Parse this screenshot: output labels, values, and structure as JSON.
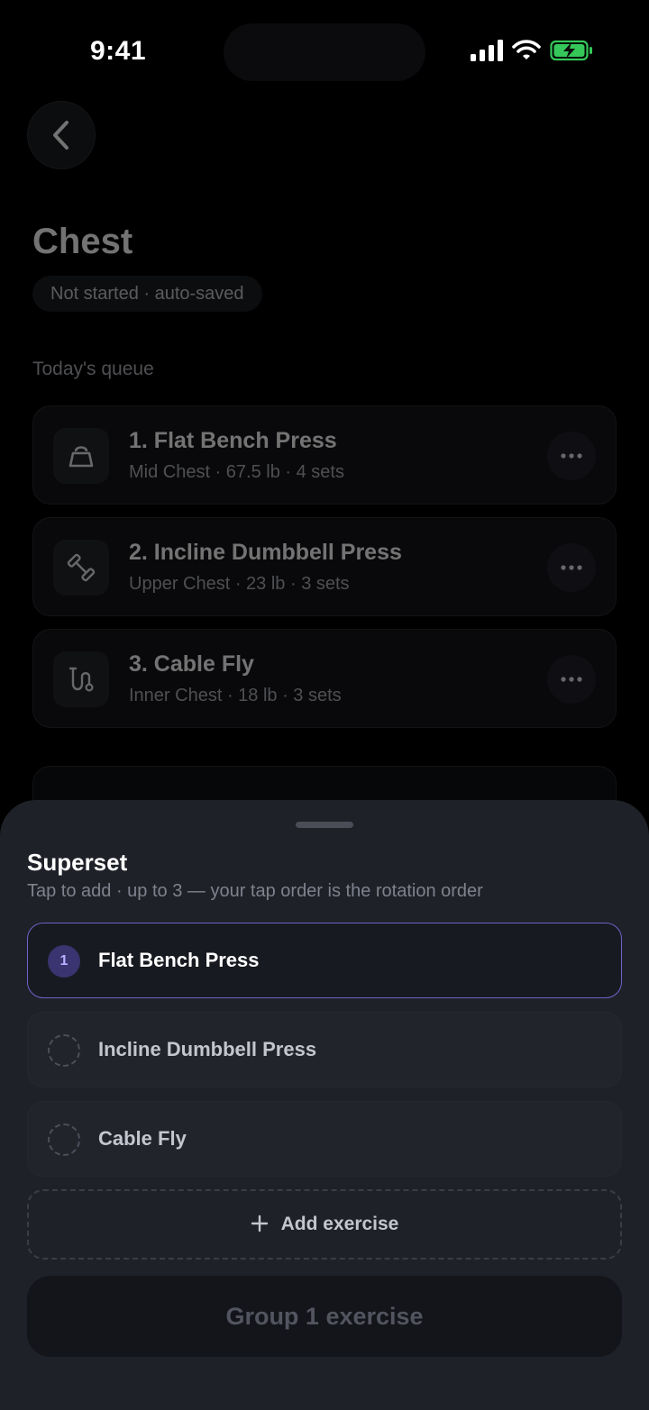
{
  "status_bar": {
    "time": "9:41"
  },
  "page": {
    "title": "Chest",
    "status_chip": "Not started · auto-saved",
    "section_label": "Today's queue",
    "queue": [
      {
        "name": "1. Flat Bench Press",
        "meta": "Mid Chest · 67.5 lb · 4 sets",
        "icon": "kettlebell-icon"
      },
      {
        "name": "2. Incline Dumbbell Press",
        "meta": "Upper Chest · 23 lb · 3 sets",
        "icon": "dumbbell-icon"
      },
      {
        "name": "3. Cable Fly",
        "meta": "Inner Chest · 18 lb · 3 sets",
        "icon": "cable-icon"
      }
    ]
  },
  "sheet": {
    "title": "Superset",
    "subtitle": "Tap to add · up to 3 — your tap order is the rotation order",
    "options": [
      {
        "label": "Flat Bench Press",
        "order": "1",
        "selected": true
      },
      {
        "label": "Incline Dumbbell Press",
        "order": "",
        "selected": false
      },
      {
        "label": "Cable Fly",
        "order": "",
        "selected": false
      }
    ],
    "add_label": "Add exercise",
    "group_button_label": "Group 1 exercise"
  },
  "colors": {
    "accent": "#6e63c8",
    "sheet_bg": "#1f2129",
    "battery": "#35c759"
  }
}
